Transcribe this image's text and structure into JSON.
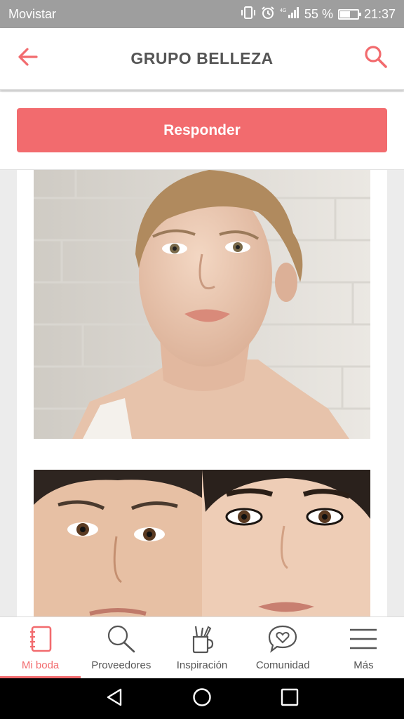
{
  "status_bar": {
    "carrier": "Movistar",
    "battery_text": "55 %",
    "battery_level": 0.55,
    "time": "21:37",
    "icons": [
      "vibrate-icon",
      "alarm-icon",
      "signal-icon",
      "battery-icon"
    ]
  },
  "header": {
    "title": "GRUPO BELLEZA",
    "back_icon": "arrow-left-icon",
    "search_icon": "search-icon"
  },
  "reply": {
    "label": "Responder"
  },
  "posts": [
    {
      "image": "woman-portrait-photo"
    },
    {
      "image": "before-after-makeup-photo"
    }
  ],
  "bottom_nav": {
    "items": [
      {
        "label": "Mi boda",
        "icon": "notebook-icon",
        "active": true
      },
      {
        "label": "Proveedores",
        "icon": "magnifier-icon",
        "active": false
      },
      {
        "label": "Inspiración",
        "icon": "brush-cup-icon",
        "active": false
      },
      {
        "label": "Comunidad",
        "icon": "heart-chat-icon",
        "active": false
      },
      {
        "label": "Más",
        "icon": "menu-icon",
        "active": false
      }
    ]
  },
  "colors": {
    "accent": "#f26b6e",
    "status_bar": "#9e9e9e",
    "title": "#555555"
  },
  "android_nav": [
    "back-triangle-icon",
    "home-circle-icon",
    "recents-square-icon"
  ]
}
